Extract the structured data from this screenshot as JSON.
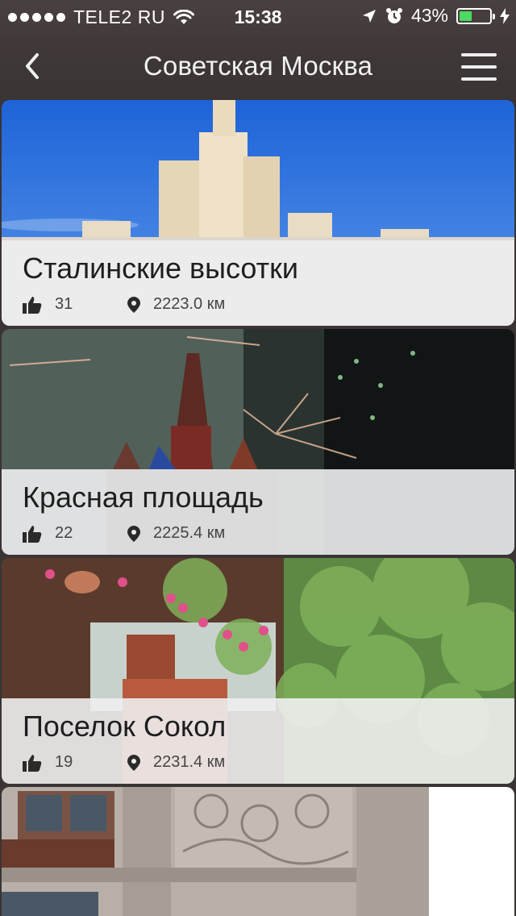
{
  "status_bar": {
    "carrier": "TELE2 RU",
    "time": "15:38",
    "battery": "43%",
    "battery_level": 0.43,
    "signal_bars": 5
  },
  "header": {
    "title": "Советская Москва",
    "back_icon": "chevron-left-icon",
    "menu_icon": "hamburger-menu-icon"
  },
  "places": [
    {
      "title": "Сталинские высотки",
      "likes": "31",
      "distance": "2223.0 км"
    },
    {
      "title": "Красная площадь",
      "likes": "22",
      "distance": "2225.4 км"
    },
    {
      "title": "Поселок Сокол",
      "likes": "19",
      "distance": "2231.4 км"
    },
    {
      "title": "",
      "likes": "",
      "distance": ""
    }
  ],
  "colors": {
    "header_bg": "#3e3737",
    "overlay": "#eeeef0",
    "battery_fill": "#4cd964"
  }
}
